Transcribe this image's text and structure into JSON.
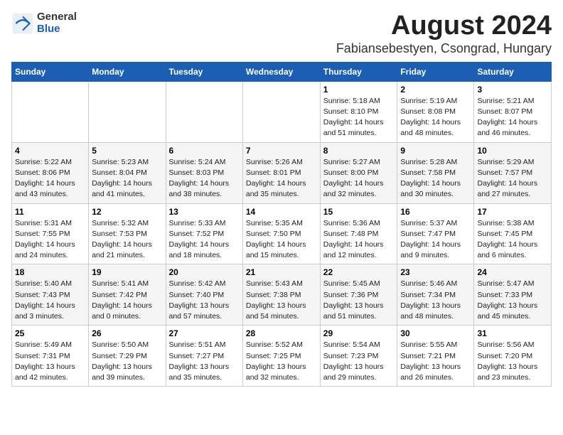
{
  "logo": {
    "general": "General",
    "blue": "Blue"
  },
  "title": {
    "month": "August 2024",
    "location": "Fabiansebestyen, Csongrad, Hungary"
  },
  "weekdays": [
    "Sunday",
    "Monday",
    "Tuesday",
    "Wednesday",
    "Thursday",
    "Friday",
    "Saturday"
  ],
  "weeks": [
    [
      {
        "day": "",
        "info": ""
      },
      {
        "day": "",
        "info": ""
      },
      {
        "day": "",
        "info": ""
      },
      {
        "day": "",
        "info": ""
      },
      {
        "day": "1",
        "info": "Sunrise: 5:18 AM\nSunset: 8:10 PM\nDaylight: 14 hours\nand 51 minutes."
      },
      {
        "day": "2",
        "info": "Sunrise: 5:19 AM\nSunset: 8:08 PM\nDaylight: 14 hours\nand 48 minutes."
      },
      {
        "day": "3",
        "info": "Sunrise: 5:21 AM\nSunset: 8:07 PM\nDaylight: 14 hours\nand 46 minutes."
      }
    ],
    [
      {
        "day": "4",
        "info": "Sunrise: 5:22 AM\nSunset: 8:06 PM\nDaylight: 14 hours\nand 43 minutes."
      },
      {
        "day": "5",
        "info": "Sunrise: 5:23 AM\nSunset: 8:04 PM\nDaylight: 14 hours\nand 41 minutes."
      },
      {
        "day": "6",
        "info": "Sunrise: 5:24 AM\nSunset: 8:03 PM\nDaylight: 14 hours\nand 38 minutes."
      },
      {
        "day": "7",
        "info": "Sunrise: 5:26 AM\nSunset: 8:01 PM\nDaylight: 14 hours\nand 35 minutes."
      },
      {
        "day": "8",
        "info": "Sunrise: 5:27 AM\nSunset: 8:00 PM\nDaylight: 14 hours\nand 32 minutes."
      },
      {
        "day": "9",
        "info": "Sunrise: 5:28 AM\nSunset: 7:58 PM\nDaylight: 14 hours\nand 30 minutes."
      },
      {
        "day": "10",
        "info": "Sunrise: 5:29 AM\nSunset: 7:57 PM\nDaylight: 14 hours\nand 27 minutes."
      }
    ],
    [
      {
        "day": "11",
        "info": "Sunrise: 5:31 AM\nSunset: 7:55 PM\nDaylight: 14 hours\nand 24 minutes."
      },
      {
        "day": "12",
        "info": "Sunrise: 5:32 AM\nSunset: 7:53 PM\nDaylight: 14 hours\nand 21 minutes."
      },
      {
        "day": "13",
        "info": "Sunrise: 5:33 AM\nSunset: 7:52 PM\nDaylight: 14 hours\nand 18 minutes."
      },
      {
        "day": "14",
        "info": "Sunrise: 5:35 AM\nSunset: 7:50 PM\nDaylight: 14 hours\nand 15 minutes."
      },
      {
        "day": "15",
        "info": "Sunrise: 5:36 AM\nSunset: 7:48 PM\nDaylight: 14 hours\nand 12 minutes."
      },
      {
        "day": "16",
        "info": "Sunrise: 5:37 AM\nSunset: 7:47 PM\nDaylight: 14 hours\nand 9 minutes."
      },
      {
        "day": "17",
        "info": "Sunrise: 5:38 AM\nSunset: 7:45 PM\nDaylight: 14 hours\nand 6 minutes."
      }
    ],
    [
      {
        "day": "18",
        "info": "Sunrise: 5:40 AM\nSunset: 7:43 PM\nDaylight: 14 hours\nand 3 minutes."
      },
      {
        "day": "19",
        "info": "Sunrise: 5:41 AM\nSunset: 7:42 PM\nDaylight: 14 hours\nand 0 minutes."
      },
      {
        "day": "20",
        "info": "Sunrise: 5:42 AM\nSunset: 7:40 PM\nDaylight: 13 hours\nand 57 minutes."
      },
      {
        "day": "21",
        "info": "Sunrise: 5:43 AM\nSunset: 7:38 PM\nDaylight: 13 hours\nand 54 minutes."
      },
      {
        "day": "22",
        "info": "Sunrise: 5:45 AM\nSunset: 7:36 PM\nDaylight: 13 hours\nand 51 minutes."
      },
      {
        "day": "23",
        "info": "Sunrise: 5:46 AM\nSunset: 7:34 PM\nDaylight: 13 hours\nand 48 minutes."
      },
      {
        "day": "24",
        "info": "Sunrise: 5:47 AM\nSunset: 7:33 PM\nDaylight: 13 hours\nand 45 minutes."
      }
    ],
    [
      {
        "day": "25",
        "info": "Sunrise: 5:49 AM\nSunset: 7:31 PM\nDaylight: 13 hours\nand 42 minutes."
      },
      {
        "day": "26",
        "info": "Sunrise: 5:50 AM\nSunset: 7:29 PM\nDaylight: 13 hours\nand 39 minutes."
      },
      {
        "day": "27",
        "info": "Sunrise: 5:51 AM\nSunset: 7:27 PM\nDaylight: 13 hours\nand 35 minutes."
      },
      {
        "day": "28",
        "info": "Sunrise: 5:52 AM\nSunset: 7:25 PM\nDaylight: 13 hours\nand 32 minutes."
      },
      {
        "day": "29",
        "info": "Sunrise: 5:54 AM\nSunset: 7:23 PM\nDaylight: 13 hours\nand 29 minutes."
      },
      {
        "day": "30",
        "info": "Sunrise: 5:55 AM\nSunset: 7:21 PM\nDaylight: 13 hours\nand 26 minutes."
      },
      {
        "day": "31",
        "info": "Sunrise: 5:56 AM\nSunset: 7:20 PM\nDaylight: 13 hours\nand 23 minutes."
      }
    ]
  ]
}
